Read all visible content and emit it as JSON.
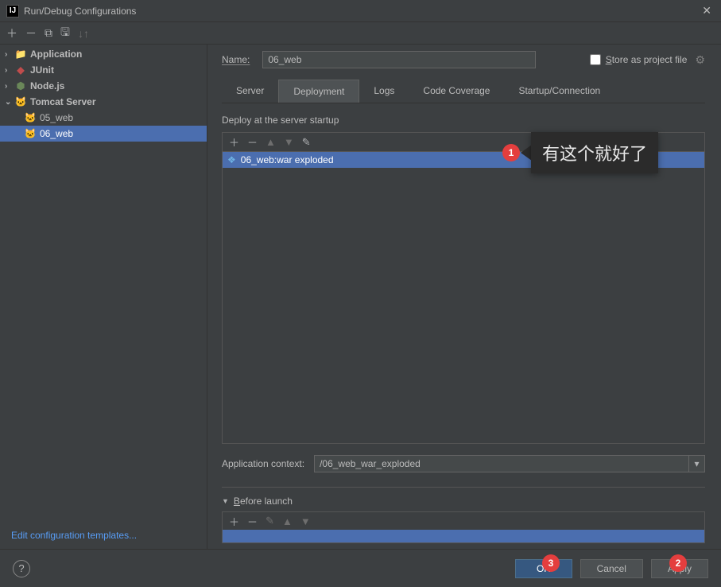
{
  "window": {
    "title": "Run/Debug Configurations"
  },
  "sidebar": {
    "items": [
      {
        "label": "Application",
        "expandable": true,
        "expanded": false,
        "icon": "folder"
      },
      {
        "label": "JUnit",
        "expandable": true,
        "expanded": false,
        "icon": "junit"
      },
      {
        "label": "Node.js",
        "expandable": true,
        "expanded": false,
        "icon": "node"
      },
      {
        "label": "Tomcat Server",
        "expandable": true,
        "expanded": true,
        "icon": "tomcat"
      }
    ],
    "tomcat_children": [
      {
        "label": "05_web"
      },
      {
        "label": "06_web",
        "selected": true
      }
    ],
    "edit_templates": "Edit configuration templates..."
  },
  "form": {
    "name_label": "Name:",
    "name_value": "06_web",
    "store_label": "Store as project file"
  },
  "tabs": {
    "items": [
      "Server",
      "Deployment",
      "Logs",
      "Code Coverage",
      "Startup/Connection"
    ],
    "active_index": 1
  },
  "deployment": {
    "heading": "Deploy at the server startup",
    "items": [
      {
        "label": "06_web:war exploded",
        "selected": true
      }
    ],
    "app_context_label": "Application context:",
    "app_context_value": "/06_web_war_exploded"
  },
  "before_launch": {
    "heading": "Before launch"
  },
  "buttons": {
    "ok": "OK",
    "cancel": "Cancel",
    "apply": "Apply"
  },
  "annotations": {
    "badge1": "1",
    "badge2": "2",
    "badge3": "3",
    "callout1": "有这个就好了"
  }
}
